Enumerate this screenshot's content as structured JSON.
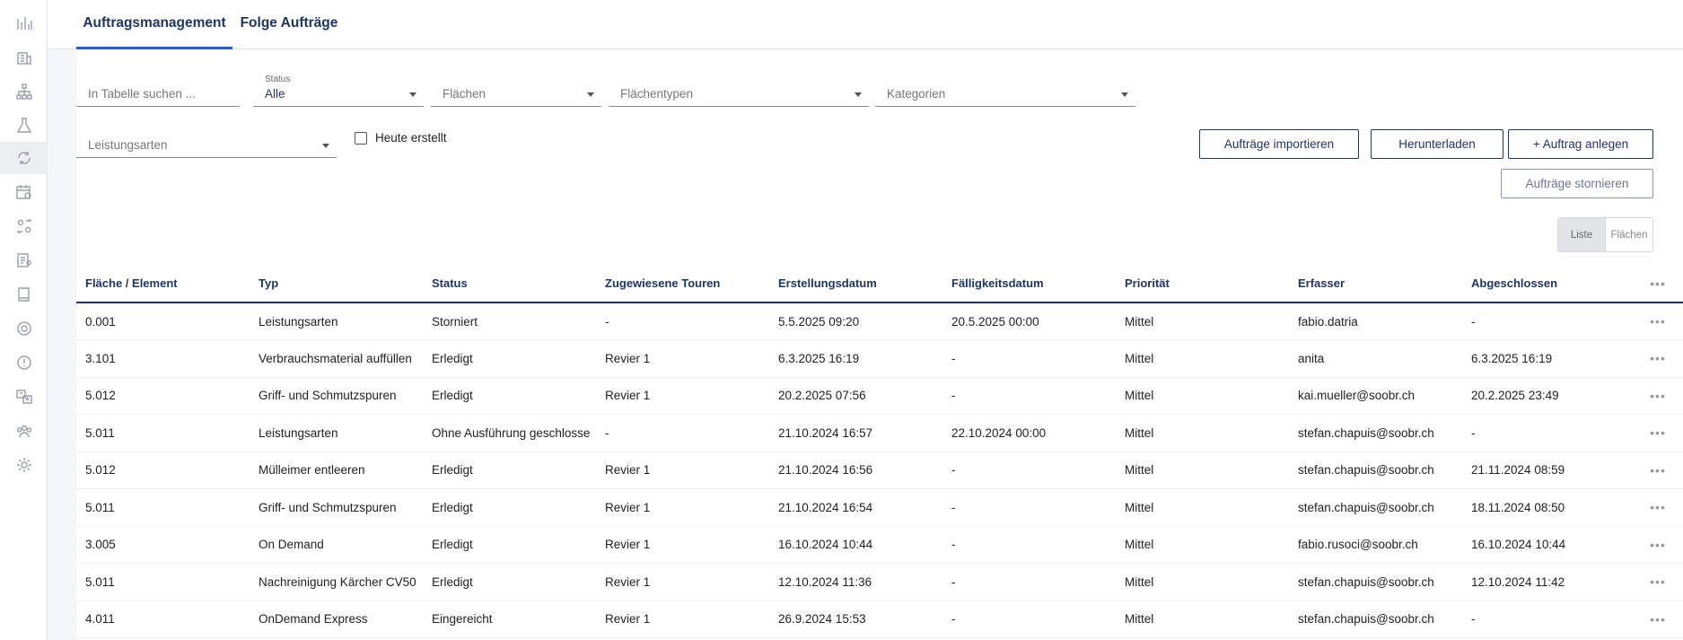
{
  "sidebar": {
    "items": [
      {
        "icon": "bar-chart-icon"
      },
      {
        "icon": "building-chart-icon"
      },
      {
        "icon": "hierarchy-icon"
      },
      {
        "icon": "flask-icon"
      },
      {
        "icon": "refresh-cycle-icon",
        "active": true
      },
      {
        "icon": "calendar-clock-icon"
      },
      {
        "icon": "swap-users-icon"
      },
      {
        "icon": "report-user-icon"
      },
      {
        "icon": "book-icon"
      },
      {
        "icon": "target-icon"
      },
      {
        "icon": "alert-circle-icon"
      },
      {
        "icon": "translate-icon"
      },
      {
        "icon": "team-icon"
      },
      {
        "icon": "gear-icon"
      }
    ]
  },
  "tabs": [
    {
      "label": "Auftragsmanagement",
      "active": true
    },
    {
      "label": "Folge Aufträge",
      "active": false
    }
  ],
  "filters": {
    "search_placeholder": "In Tabelle suchen ...",
    "status_label": "Status",
    "status_value": "Alle",
    "flaechen_placeholder": "Flächen",
    "flaechentypen_placeholder": "Flächentypen",
    "kategorien_placeholder": "Kategorien",
    "leistungsarten_placeholder": "Leistungsarten",
    "heute_erstellt_label": "Heute erstellt"
  },
  "actions": {
    "import_label": "Aufträge importieren",
    "download_label": "Herunterladen",
    "create_label": "+ Auftrag anlegen",
    "cancel_label": "Aufträge stornieren"
  },
  "view_toggle": {
    "list_label": "Liste",
    "areas_label": "Flächen"
  },
  "table": {
    "columns": [
      "Fläche / Element",
      "Typ",
      "Status",
      "Zugewiesene Touren",
      "Erstellungsdatum",
      "Fälligkeitsdatum",
      "Priorität",
      "Erfasser",
      "Abgeschlossen"
    ],
    "more_label": "•••",
    "rows": [
      [
        "0.001",
        "Leistungsarten",
        "Storniert",
        "-",
        "5.5.2025 09:20",
        "20.5.2025 00:00",
        "Mittel",
        "fabio.datria",
        "-"
      ],
      [
        "3.101",
        "Verbrauchsmaterial auffüllen",
        "Erledigt",
        "Revier 1",
        "6.3.2025 16:19",
        "-",
        "Mittel",
        "anita",
        "6.3.2025 16:19"
      ],
      [
        "5.012",
        "Griff- und Schmutzspuren",
        "Erledigt",
        "Revier 1",
        "20.2.2025 07:56",
        "-",
        "Mittel",
        "kai.mueller@soobr.ch",
        "20.2.2025 23:49"
      ],
      [
        "5.011",
        "Leistungsarten",
        "Ohne Ausführung geschlosse",
        "-",
        "21.10.2024 16:57",
        "22.10.2024 00:00",
        "Mittel",
        "stefan.chapuis@soobr.ch",
        "-"
      ],
      [
        "5.012",
        "Mülleimer entleeren",
        "Erledigt",
        "Revier 1",
        "21.10.2024 16:56",
        "-",
        "Mittel",
        "stefan.chapuis@soobr.ch",
        "21.11.2024 08:59"
      ],
      [
        "5.011",
        "Griff- und Schmutzspuren",
        "Erledigt",
        "Revier 1",
        "21.10.2024 16:54",
        "-",
        "Mittel",
        "stefan.chapuis@soobr.ch",
        "18.11.2024 08:50"
      ],
      [
        "3.005",
        "On Demand",
        "Erledigt",
        "Revier 1",
        "16.10.2024 10:44",
        "-",
        "Mittel",
        "fabio.rusoci@soobr.ch",
        "16.10.2024 10:44"
      ],
      [
        "5.011",
        "Nachreinigung Kärcher CV50",
        "Erledigt",
        "Revier 1",
        "12.10.2024 11:36",
        "-",
        "Mittel",
        "stefan.chapuis@soobr.ch",
        "12.10.2024 11:42"
      ],
      [
        "4.011",
        "OnDemand Express",
        "Eingereicht",
        "Revier 1",
        "26.9.2024 15:53",
        "-",
        "Mittel",
        "stefan.chapuis@soobr.ch",
        "-"
      ]
    ]
  }
}
